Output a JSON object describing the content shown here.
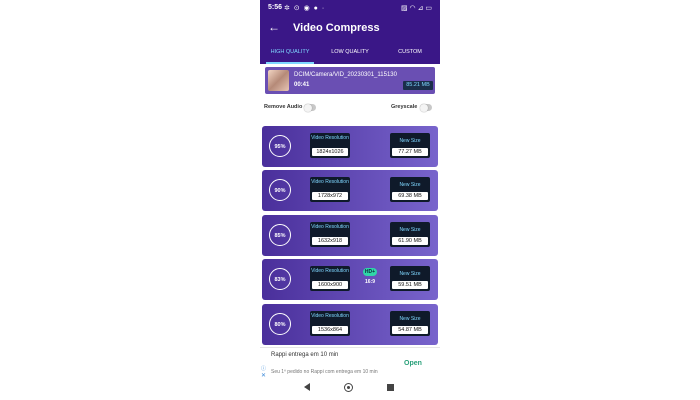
{
  "status_bar": {
    "time": "5:56",
    "left_icons": "✲ ⊙ ◉ ● ·",
    "right_icons": "▨ ◠ ⊿ ▭"
  },
  "appbar": {
    "back_icon": "←",
    "title": "Video Compress"
  },
  "tabs": [
    {
      "label": "HIGH QUALITY",
      "active": true
    },
    {
      "label": "LOW QUALITY",
      "active": false
    },
    {
      "label": "CUSTOM",
      "active": false
    }
  ],
  "video": {
    "path": "DCIM/Camera/VID_20230301_115130",
    "duration": "00:41",
    "size": "85.21 MB"
  },
  "options": {
    "remove_audio_label": "Remove Audio",
    "remove_audio_on": false,
    "greyscale_label": "Greyscale",
    "greyscale_on": false
  },
  "quality_options": [
    {
      "percent": "95%",
      "res_label": "Video Resolution",
      "resolution": "1824x1026",
      "size_label": "New Size",
      "new_size": "77.27 MB"
    },
    {
      "percent": "90%",
      "res_label": "Video Resolution",
      "resolution": "1728x972",
      "size_label": "New Size",
      "new_size": "69.38 MB"
    },
    {
      "percent": "85%",
      "res_label": "Video Resolution",
      "resolution": "1632x918",
      "size_label": "New Size",
      "new_size": "61.90 MB"
    },
    {
      "percent": "83%",
      "res_label": "Video Resolution",
      "resolution": "1600x900",
      "size_label": "New Size",
      "new_size": "59.51 MB",
      "badge": "HD+",
      "ratio": "16:9"
    },
    {
      "percent": "80%",
      "res_label": "Video Resolution",
      "resolution": "1536x864",
      "size_label": "New Size",
      "new_size": "54.87 MB"
    }
  ],
  "ad": {
    "title": "Rappi entrega em 10 min",
    "subtitle": "Seu 1º pedido no Rappi com entrega em 10 min",
    "cta": "Open",
    "info_icon": "ⓘ",
    "close_icon": "✕"
  },
  "colors": {
    "header": "#3a1787",
    "card_start": "#4a2f9b",
    "card_end": "#7864cc",
    "accent": "#7fd7ff",
    "cta": "#2aa07a"
  }
}
